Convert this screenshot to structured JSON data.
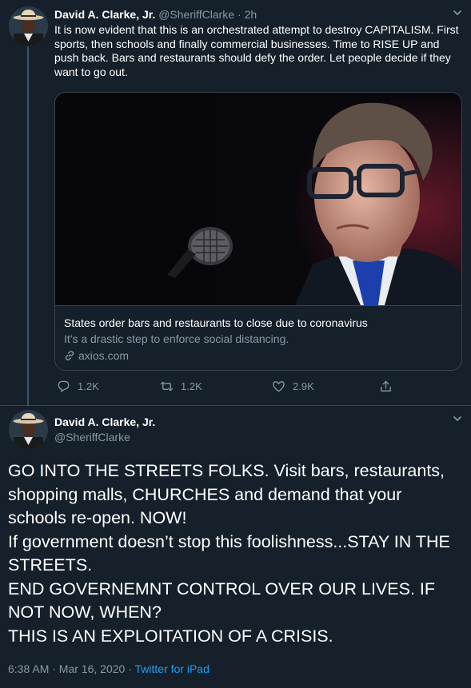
{
  "tweet1": {
    "author_name": "David A. Clarke, Jr.",
    "handle": "@SheriffClarke",
    "separator": "·",
    "time": "2h",
    "text": "It is now evident that this is an orchestrated attempt to destroy CAPITALISM. First sports, then schools and finally commercial businesses. Time to RISE UP and push back. Bars and restaurants should defy the order. Let people decide if they want to go out.",
    "card": {
      "title": "States order bars and restaurants to close due to coronavirus",
      "description": "It's a drastic step to enforce social distancing.",
      "domain": "axios.com",
      "domain_icon": "link-icon"
    },
    "actions": {
      "reply_count": "1.2K",
      "retweet_count": "1.2K",
      "like_count": "2.9K",
      "reply_icon": "reply-icon",
      "retweet_icon": "retweet-icon",
      "like_icon": "heart-icon",
      "share_icon": "share-icon"
    }
  },
  "tweet2": {
    "author_name": "David A. Clarke, Jr.",
    "handle": "@SheriffClarke",
    "lines": [
      "GO INTO THE STREETS FOLKS. Visit bars, restaurants, shopping malls, CHURCHES and demand that your schools re-open. NOW!",
      "If government doesn’t stop this foolishness...STAY IN THE STREETS.",
      "END GOVERNEMNT CONTROL OVER OUR LIVES. IF NOT NOW, WHEN?",
      "THIS IS AN EXPLOITATION OF A CRISIS."
    ],
    "timestamp": "6:38 AM · Mar 16, 2020",
    "meta_separator": " · ",
    "source": "Twitter for iPad"
  },
  "colors": {
    "background": "#15202b",
    "border": "#38444d",
    "muted_text": "#8899a6",
    "link": "#1da1f2",
    "text": "#ffffff"
  }
}
